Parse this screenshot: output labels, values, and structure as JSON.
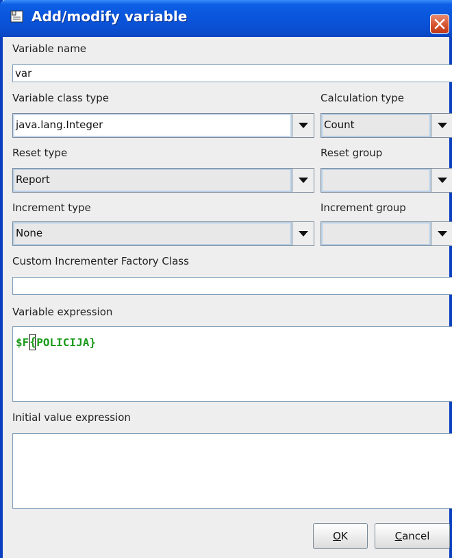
{
  "window": {
    "title": "Add/modify variable"
  },
  "fields": {
    "variable_name_label": "Variable name",
    "variable_name_value": "var",
    "class_type_label": "Variable class type",
    "class_type_value": "java.lang.Integer",
    "calculation_type_label": "Calculation type",
    "calculation_type_value": "Count",
    "reset_type_label": "Reset type",
    "reset_type_value": "Report",
    "reset_group_label": "Reset group",
    "reset_group_value": "",
    "increment_type_label": "Increment type",
    "increment_type_value": "None",
    "increment_group_label": "Increment group",
    "increment_group_value": "",
    "incrementer_label": "Custom Incrementer Factory Class",
    "incrementer_value": "",
    "expression_label": "Variable expression",
    "expression_prefix": "$F",
    "expression_caret_char": "{",
    "expression_suffix": "POLICIJA}",
    "initial_value_label": "Initial value expression",
    "initial_value_value": ""
  },
  "buttons": {
    "ok_mnemonic": "O",
    "ok_rest": "K",
    "cancel_mnemonic": "C",
    "cancel_rest": "ancel"
  },
  "icons": {
    "title_icon": "document-icon",
    "close_icon": "close-icon",
    "dropdown_icon": "chevron-down-icon"
  },
  "colors": {
    "titlebar": "#0a56dc",
    "close": "#d44f2c",
    "expression_text": "#1a9a1a"
  }
}
